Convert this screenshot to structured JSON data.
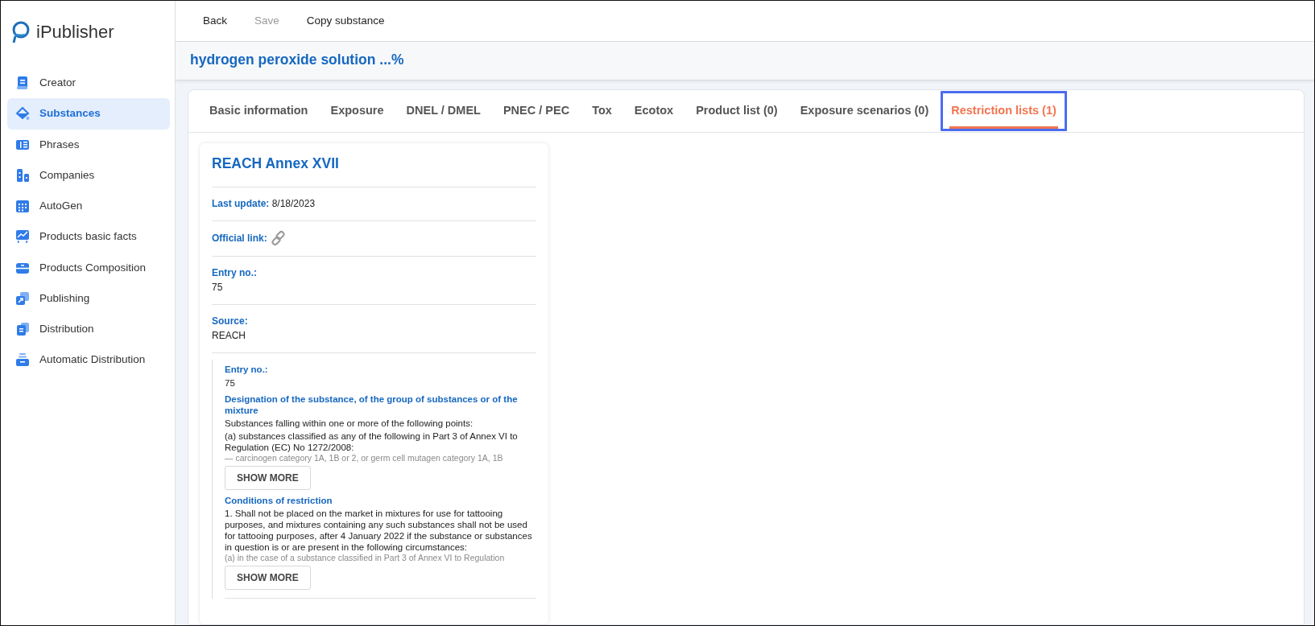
{
  "logo": {
    "text": "iPublisher"
  },
  "sidebar": {
    "items": [
      {
        "label": "Creator",
        "selected": false
      },
      {
        "label": "Substances",
        "selected": true
      },
      {
        "label": "Phrases",
        "selected": false
      },
      {
        "label": "Companies",
        "selected": false
      },
      {
        "label": "AutoGen",
        "selected": false
      },
      {
        "label": "Products basic facts",
        "selected": false
      },
      {
        "label": "Products Composition",
        "selected": false
      },
      {
        "label": "Publishing",
        "selected": false
      },
      {
        "label": "Distribution",
        "selected": false
      },
      {
        "label": "Automatic Distribution",
        "selected": false
      }
    ]
  },
  "toolbar": {
    "buttons": [
      {
        "label": "Back",
        "disabled": false
      },
      {
        "label": "Save",
        "disabled": true
      },
      {
        "label": "Copy substance",
        "disabled": false
      }
    ]
  },
  "page_title": "hydrogen peroxide solution ...%",
  "tabs": [
    {
      "label": "Basic information",
      "selected": false,
      "highlighted": false
    },
    {
      "label": "Exposure",
      "selected": false,
      "highlighted": false
    },
    {
      "label": "DNEL / DMEL",
      "selected": false,
      "highlighted": false
    },
    {
      "label": "PNEC / PEC",
      "selected": false,
      "highlighted": false
    },
    {
      "label": "Tox",
      "selected": false,
      "highlighted": false
    },
    {
      "label": "Ecotox",
      "selected": false,
      "highlighted": false
    },
    {
      "label": "Product list (0)",
      "selected": false,
      "highlighted": false
    },
    {
      "label": "Exposure scenarios (0)",
      "selected": false,
      "highlighted": false
    },
    {
      "label": "Restriction lists (1)",
      "selected": true,
      "highlighted": true
    }
  ],
  "restriction_card": {
    "title": "REACH Annex XVII",
    "fields": [
      {
        "kind": "inline",
        "label": "Last update:",
        "value": "8/18/2023"
      },
      {
        "kind": "link",
        "label": "Official link:"
      },
      {
        "kind": "block",
        "label": "Entry no.:",
        "value": "75"
      },
      {
        "kind": "block",
        "label": "Source:",
        "value": "REACH"
      }
    ],
    "entry": {
      "label": "Entry no.:",
      "value": "75",
      "sections": [
        {
          "heading": "Designation of the substance, of the group of substances or of the mixture",
          "lines": [
            "Substances falling within one or more of the following points:",
            "(a) substances classified as any of the following in Part 3 of Annex VI to Regulation (EC) No 1272/2008:"
          ],
          "faded_line": "— carcinogen category 1A, 1B or 2, or germ cell mutagen category 1A, 1B",
          "button": "SHOW MORE"
        },
        {
          "heading": "Conditions of restriction",
          "lines": [
            "1. Shall not be placed on the market in mixtures for use for tattooing purposes, and mixtures containing any such substances shall not be used for tattooing purposes, after 4 January 2022 if the substance or substances in question is or are present in the following circumstances:"
          ],
          "faded_line": "(a) in the case of a substance classified in Part 3 of Annex VI to Regulation",
          "button": "SHOW MORE"
        }
      ]
    }
  }
}
